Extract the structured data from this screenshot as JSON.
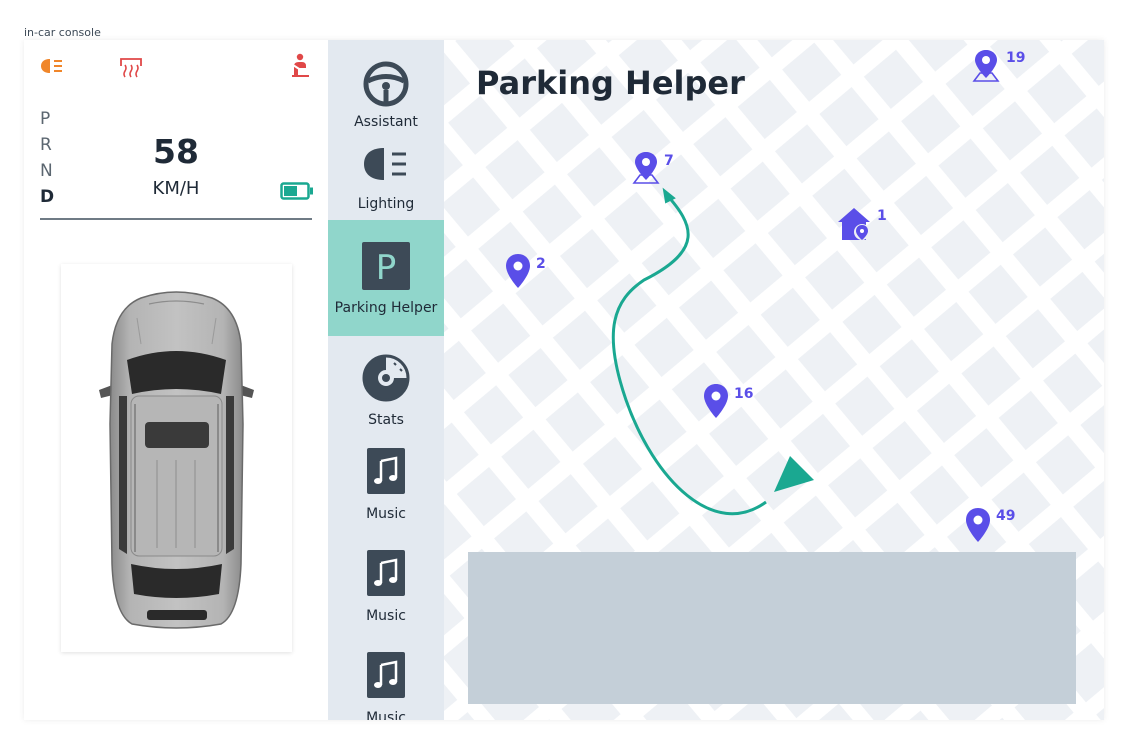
{
  "caption": "in-car console",
  "indicators": [
    {
      "icon": "headlight-icon",
      "color": "#f0862a"
    },
    {
      "icon": "rear-defrost-icon",
      "color": "#e04848"
    },
    {
      "icon": "seatbelt-icon",
      "color": "#e04848"
    }
  ],
  "gears": [
    "P",
    "R",
    "N",
    "D"
  ],
  "active_gear": "D",
  "speed": "58",
  "speed_unit": "KM/H",
  "battery": {
    "icon": "battery-icon",
    "color": "#1aa891"
  },
  "nav": {
    "items": [
      {
        "label": "Assistant",
        "icon": "steering-wheel-icon"
      },
      {
        "label": "Lighting",
        "icon": "headlight-icon"
      },
      {
        "label": "Parking Helper",
        "icon": "parking-icon",
        "active": true
      },
      {
        "label": "Stats",
        "icon": "gauge-icon"
      },
      {
        "label": "Music",
        "icon": "music-icon"
      },
      {
        "label": "Music",
        "icon": "music-icon"
      },
      {
        "label": "Music",
        "icon": "music-icon"
      }
    ]
  },
  "map": {
    "title": "Parking Helper",
    "pins": [
      {
        "number": "19",
        "icon": "location-pin-map-icon"
      },
      {
        "number": "7",
        "icon": "location-pin-map-icon"
      },
      {
        "number": "1",
        "icon": "home-pin-icon"
      },
      {
        "number": "2",
        "icon": "location-pin-icon"
      },
      {
        "number": "16",
        "icon": "location-pin-icon"
      },
      {
        "number": "49",
        "icon": "location-pin-icon"
      }
    ],
    "route_color": "#1aa891",
    "pin_color": "#5a4ee8"
  },
  "colors": {
    "nav_bg": "#e3e9f0",
    "nav_active": "#90d6cb",
    "map_bg": "#eef1f5",
    "map_blocks": "#ffffff",
    "info_panel": "#c4cfd8",
    "text_dark": "#1f2a37"
  }
}
